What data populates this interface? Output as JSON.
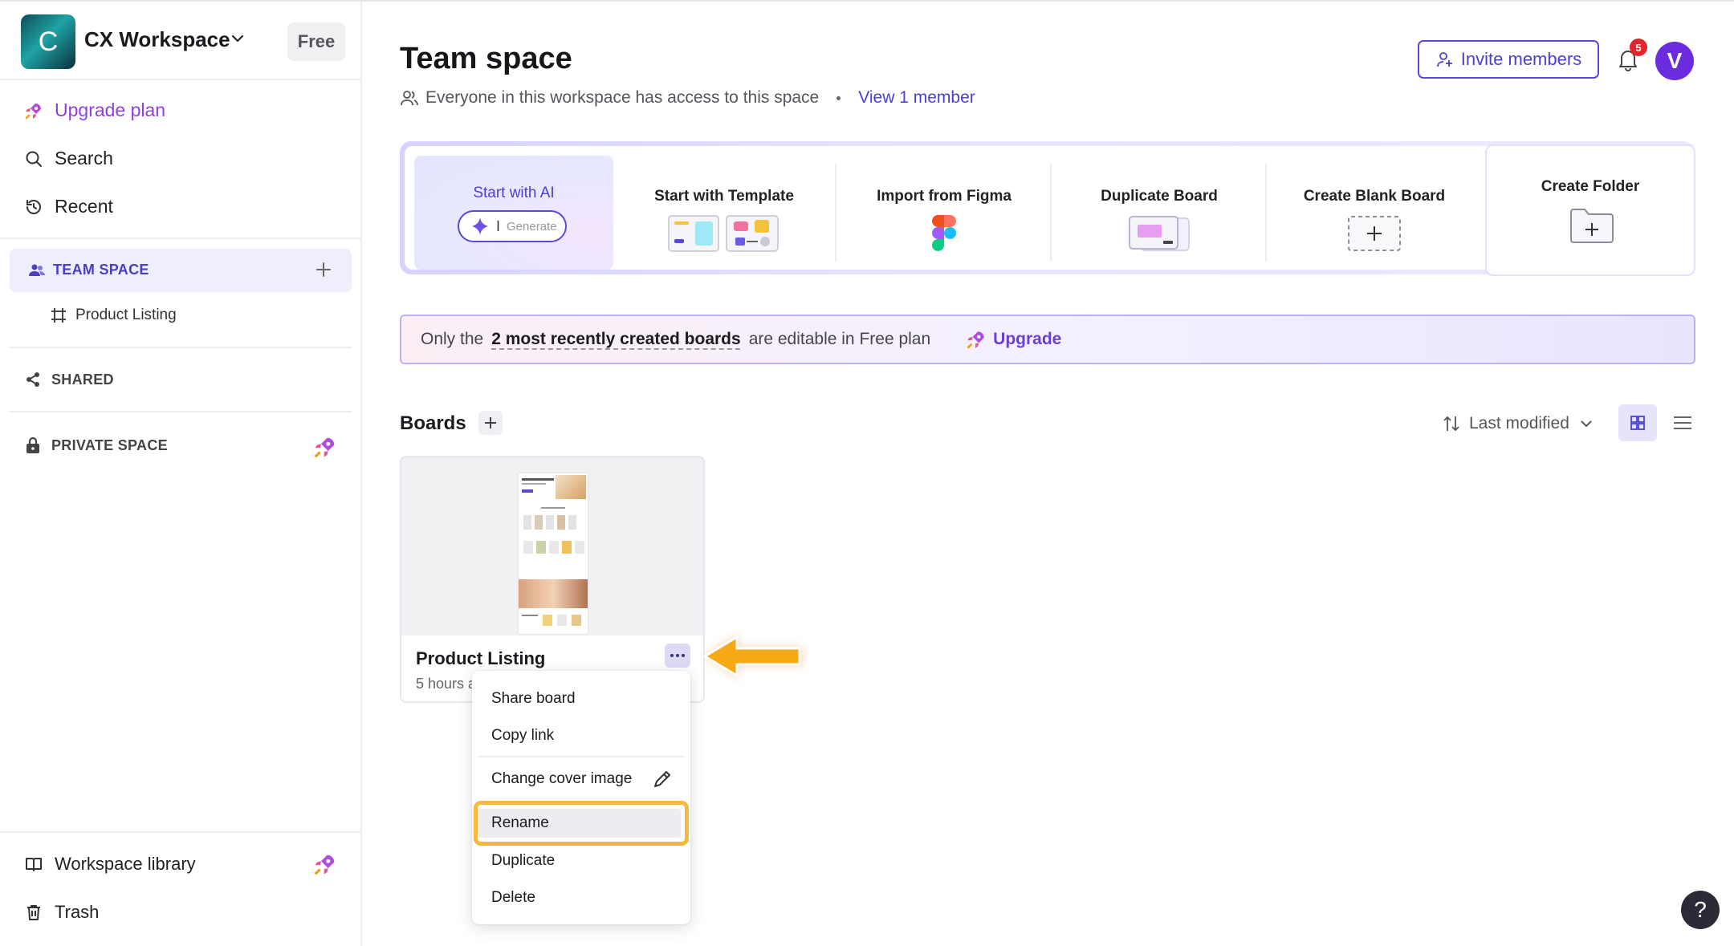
{
  "workspace": {
    "initial": "C",
    "name": "CX Workspace",
    "plan_badge": "Free"
  },
  "sidebar": {
    "upgrade_label": "Upgrade plan",
    "search_label": "Search",
    "recent_label": "Recent",
    "team_space_label": "TEAM SPACE",
    "team_items": [
      "Product Listing"
    ],
    "shared_label": "SHARED",
    "private_label": "PRIVATE SPACE",
    "library_label": "Workspace library",
    "trash_label": "Trash"
  },
  "header": {
    "title": "Team space",
    "access_text": "Everyone in this workspace has access to this space",
    "view_members_link": "View 1 member",
    "invite_label": "Invite members",
    "notification_count": "5",
    "avatar_letter": "V"
  },
  "actions": {
    "ai_title": "Start with AI",
    "ai_placeholder": "Generate",
    "template_title": "Start with Template",
    "figma_title": "Import from Figma",
    "duplicate_title": "Duplicate Board",
    "blank_title": "Create Blank Board",
    "folder_title": "Create Folder"
  },
  "banner": {
    "prefix": "Only the",
    "highlight": "2 most recently created boards",
    "suffix": "are editable in Free plan",
    "upgrade_label": "Upgrade"
  },
  "boards": {
    "heading": "Boards",
    "sort_label": "Last modified",
    "items": [
      {
        "title": "Product Listing",
        "subtitle": "5 hours a"
      }
    ]
  },
  "context_menu": {
    "items": [
      "Share board",
      "Copy link",
      "Change cover image",
      "Rename",
      "Duplicate",
      "Delete"
    ]
  },
  "help_label": "?",
  "colors": {
    "accent": "#4a3fd6",
    "highlight": "#f6b93b",
    "badge": "#e0262a",
    "avatar": "#6b2bdf"
  }
}
